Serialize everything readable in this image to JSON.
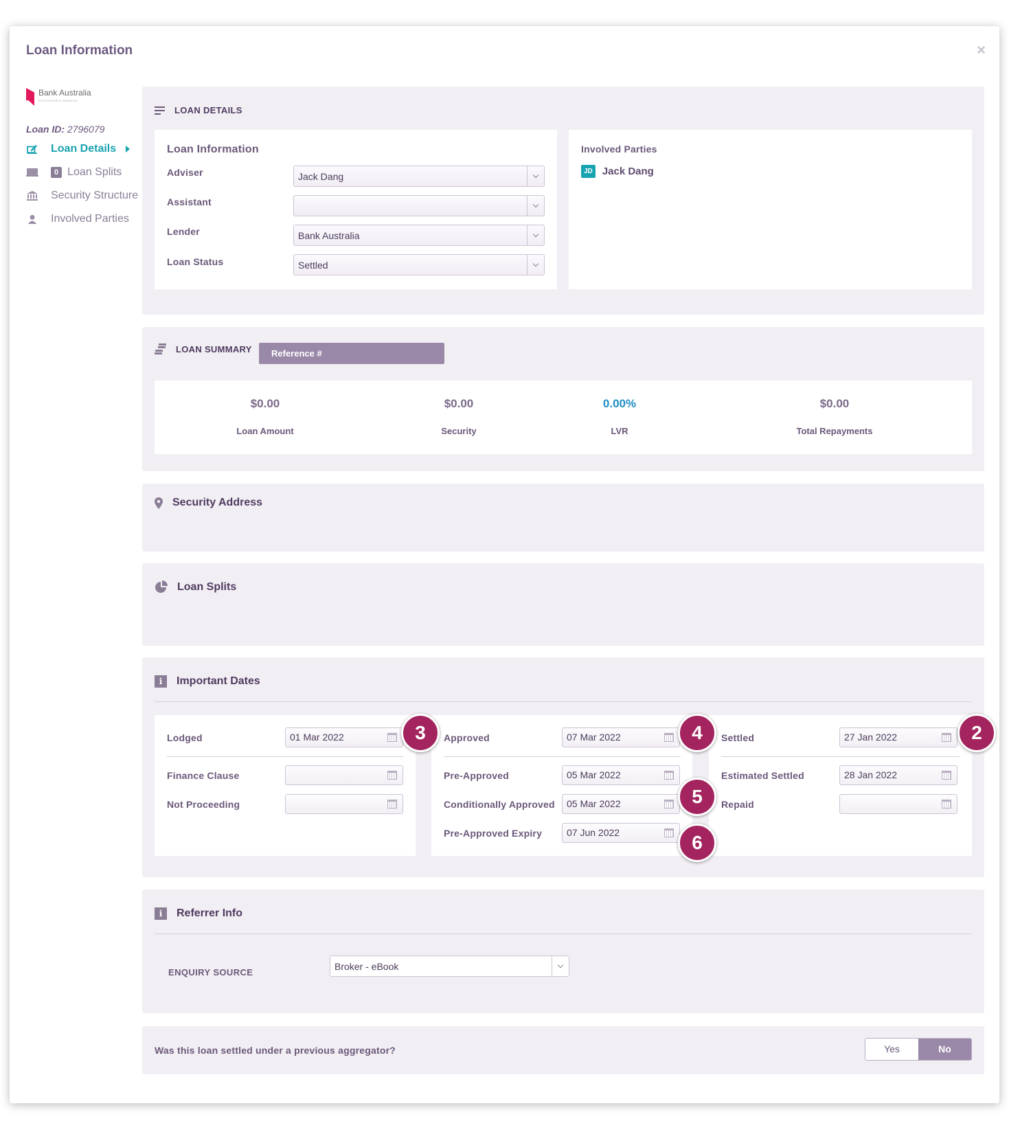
{
  "modal": {
    "title": "Loan Information",
    "close_label": "×"
  },
  "sidebar": {
    "brand_name": "Bank Australia",
    "brand_tagline": "RESPONSIBLE BANKING",
    "loan_id_label": "Loan ID:",
    "loan_id_value": "2796079",
    "items": [
      {
        "label": "Loan Details",
        "active": true
      },
      {
        "label": "Loan Splits",
        "badge": "0"
      },
      {
        "label": "Security Structure"
      },
      {
        "label": "Involved Parties"
      }
    ]
  },
  "loan_details": {
    "heading": "LOAN DETAILS",
    "info_heading": "Loan Information",
    "fields": [
      {
        "label": "Adviser",
        "value": "Jack Dang"
      },
      {
        "label": "Assistant",
        "value": ""
      },
      {
        "label": "Lender",
        "value": "Bank Australia"
      },
      {
        "label": "Loan Status",
        "value": "Settled"
      }
    ],
    "parties_heading": "Involved Parties",
    "party": {
      "initials": "JD",
      "name": "Jack Dang"
    }
  },
  "loan_summary": {
    "heading": "LOAN SUMMARY",
    "reference_label": "Reference #",
    "stats": [
      {
        "value": "$0.00",
        "label": "Loan Amount"
      },
      {
        "value": "$0.00",
        "label": "Security"
      },
      {
        "value": "0.00%",
        "label": "LVR"
      },
      {
        "value": "$0.00",
        "label": "Total Repayments"
      }
    ]
  },
  "security_address": {
    "heading": "Security Address"
  },
  "loan_splits": {
    "heading": "Loan Splits"
  },
  "important_dates": {
    "heading": "Important Dates",
    "col1": [
      {
        "label": "Lodged",
        "value": "01 Mar 2022"
      },
      {
        "label": "Finance Clause",
        "value": ""
      },
      {
        "label": "Not Proceeding",
        "value": ""
      }
    ],
    "col2": [
      {
        "label": "Approved",
        "value": "07 Mar 2022"
      },
      {
        "label": "Pre-Approved",
        "value": "05 Mar 2022"
      },
      {
        "label": "Conditionally Approved",
        "value": "05 Mar 2022"
      },
      {
        "label": "Pre-Approved Expiry",
        "value": "07 Jun 2022"
      }
    ],
    "col3": [
      {
        "label": "Settled",
        "value": "27 Jan 2022"
      },
      {
        "label": "Estimated Settled",
        "value": "28 Jan 2022"
      },
      {
        "label": "Repaid",
        "value": ""
      }
    ],
    "markers": [
      "3",
      "4",
      "2",
      "5",
      "6"
    ]
  },
  "referrer": {
    "heading": "Referrer Info",
    "source_label": "ENQUIRY SOURCE",
    "source_value": "Broker - eBook"
  },
  "aggregator": {
    "question": "Was this loan settled under a previous aggregator?",
    "yes_label": "Yes",
    "no_label": "No",
    "selected": "No"
  },
  "colors": {
    "accent": "#18a3b0",
    "purple": "#6d5a80",
    "marker": "#a3245e"
  }
}
